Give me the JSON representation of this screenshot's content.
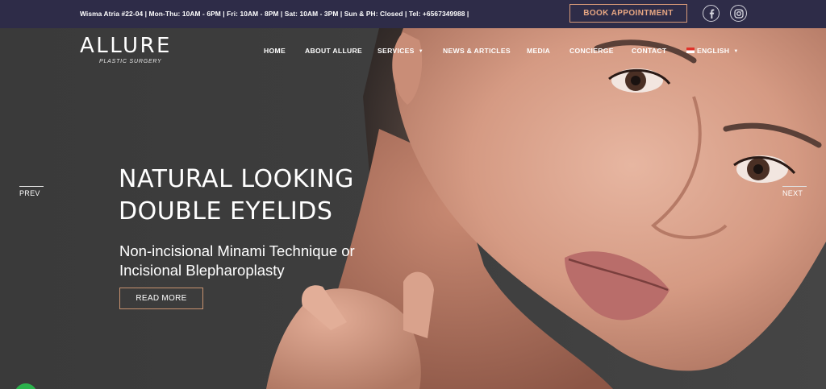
{
  "topbar": {
    "info_text": "Wisma Atria #22-04 | Mon-Thu: 10AM - 6PM | Fri: 10AM - 8PM | Sat: 10AM - 3PM | Sun & PH: Closed | Tel: +6567349988 |",
    "book_label": "BOOK APPOINTMENT",
    "social": [
      "facebook-icon",
      "instagram-icon"
    ]
  },
  "logo": {
    "name": "ALLURE",
    "tagline": "PLASTIC SURGERY"
  },
  "nav": {
    "items": [
      "HOME",
      "ABOUT ALLURE",
      "SERVICES",
      "NEWS & ARTICLES",
      "MEDIA",
      "CONCIERGE",
      "CONTACT",
      "ENGLISH"
    ]
  },
  "slide": {
    "headline_line1": "NATURAL LOOKING",
    "headline_line2": "DOUBLE EYELIDS",
    "sub_line1": "Non-incisional Minami Technique or",
    "sub_line2": "Incisional Blepharoplasty",
    "cta_label": "READ MORE",
    "prev_label": "PREV",
    "next_label": "NEXT"
  },
  "colors": {
    "topbar_bg": "#2e2c48",
    "accent": "#e8a783",
    "hero_bg": "#3b3b3b"
  }
}
